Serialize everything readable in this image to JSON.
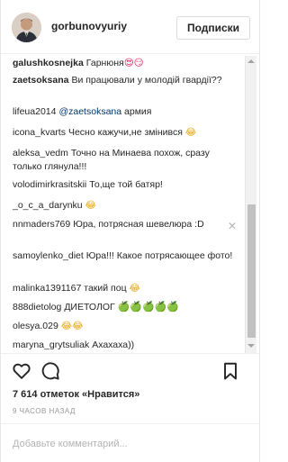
{
  "header": {
    "username": "gorbunovyuriy",
    "follow_label": "Подписки"
  },
  "comments": [
    {
      "user": "galushkosnejka",
      "text": "Гарнюня",
      "emoji": "😍😏"
    },
    {
      "user": "zaetsoksana",
      "text": "Ви працювали у молодій гвардії??"
    },
    {
      "user": "lifeua2014",
      "mention": "@zaetsoksana",
      "text": "армия"
    },
    {
      "user": "icona_kvarts",
      "text": "Чесно кажучи,не змінився",
      "emoji": "😂"
    },
    {
      "user": "aleksa_vedm",
      "text": "Точно на Минаева похож, сразу только глянула!!!"
    },
    {
      "user": "volodimirkrasitskii",
      "text": "То,ще той батяр!"
    },
    {
      "user": "_o_c_a_darynku",
      "text": "",
      "emoji": "😂"
    },
    {
      "user": "nnmaders769",
      "text": "Юра, потрясная шевелюра :D"
    },
    {
      "user": "samoylenko_diet",
      "text": "Юра!!! Какое потрясающее фото!"
    },
    {
      "user": "malinka1391167",
      "text": "такий поц",
      "emoji": "😂"
    },
    {
      "user": "888dietolog",
      "text": "ДИЕТОЛОГ",
      "emoji": "🍏🍏🍏🍏🍏"
    },
    {
      "user": "olesya.029",
      "text": "",
      "emoji": "😂😂"
    },
    {
      "user": "maryna_grytsuliak",
      "text": "Ахахаха))"
    }
  ],
  "likes_text": "7 614 отметок «Нравится»",
  "timestamp": "9 ЧАСОВ НАЗАД",
  "comment_input": {
    "placeholder": "Добавьте комментарий..."
  },
  "icons": [
    "heart-icon",
    "comment-icon",
    "bookmark-icon",
    "remove-x-icon"
  ],
  "colors": {
    "text": "#262626",
    "mention": "#003569",
    "muted": "#999999",
    "border": "#efefef"
  }
}
